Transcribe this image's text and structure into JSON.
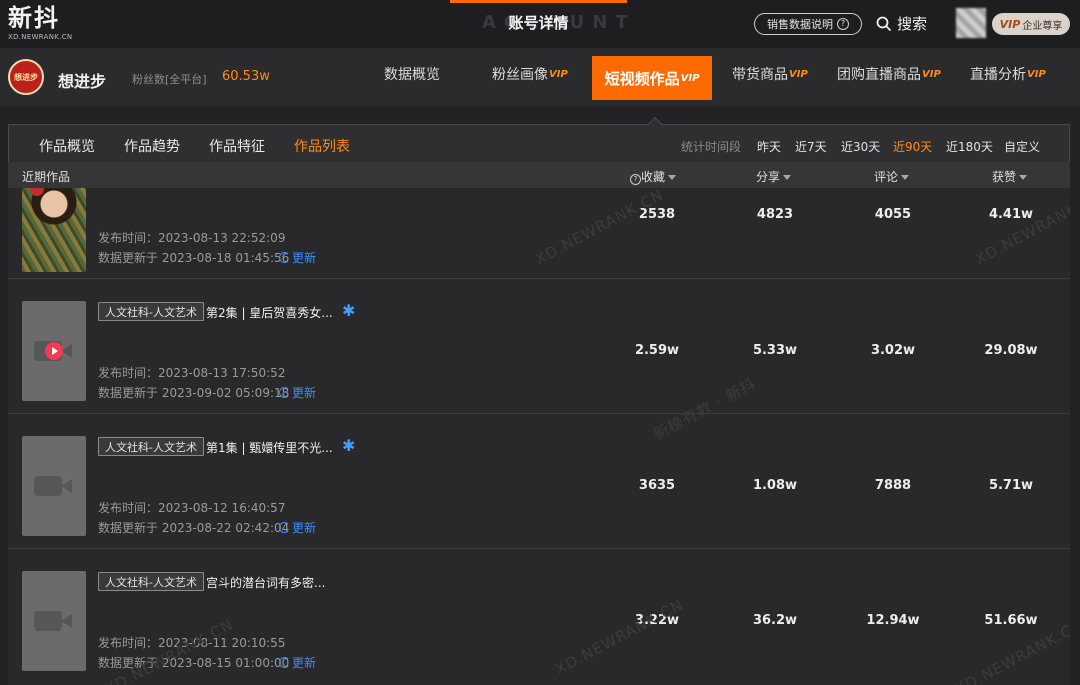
{
  "header": {
    "logo_text": "新抖",
    "logo_sub": "XD.NEWRANK.CN",
    "page_title": "账号详情",
    "page_title_ghost": "ACCOUNT",
    "sales_help": "销售数据说明",
    "search_label": "搜索",
    "vip_label": "VIP",
    "vip_text": "企业尊享"
  },
  "account": {
    "avatar_text": "想进步",
    "name": "想进步",
    "fans_label": "粉丝数[全平台]",
    "fans_value": "60.53w"
  },
  "nav_tabs": [
    {
      "label": "数据概览",
      "vip": ""
    },
    {
      "label": "粉丝画像",
      "vip": "VIP"
    },
    {
      "label": "短视频作品",
      "vip": "VIP"
    },
    {
      "label": "带货商品",
      "vip": "VIP"
    },
    {
      "label": "团购直播商品",
      "vip": "VIP"
    },
    {
      "label": "直播分析",
      "vip": "VIP"
    }
  ],
  "active_nav": "短视频作品",
  "sub_tabs": [
    "作品概览",
    "作品趋势",
    "作品特征",
    "作品列表"
  ],
  "active_sub_tab": "作品列表",
  "period": {
    "label": "统计时间段",
    "options": [
      "昨天",
      "近7天",
      "近30天",
      "近90天",
      "近180天",
      "自定义"
    ],
    "active": "近90天"
  },
  "table": {
    "section_label": "近期作品",
    "columns": [
      "收藏",
      "分享",
      "评论",
      "获赞"
    ],
    "rows": [
      {
        "category": "",
        "title": "",
        "publish_time": "发布时间：2023-08-13 22:52:09",
        "updated_time": "数据更新于 2023-08-18 01:45:56",
        "refresh_label": "更新",
        "collect": "2538",
        "share": "4823",
        "comment": "4055",
        "likes": "4.41w"
      },
      {
        "category": "人文社科-人文艺术",
        "title": "第2集 | 皇后贺喜秀女...",
        "publish_time": "发布时间：2023-08-13 17:50:52",
        "updated_time": "数据更新于 2023-09-02 05:09:18",
        "refresh_label": "更新",
        "collect": "2.59w",
        "share": "5.33w",
        "comment": "3.02w",
        "likes": "29.08w"
      },
      {
        "category": "人文社科-人文艺术",
        "title": "第1集 | 甄嬛传里不光...",
        "publish_time": "发布时间：2023-08-12 16:40:57",
        "updated_time": "数据更新于 2023-08-22 02:42:04",
        "refresh_label": "更新",
        "collect": "3635",
        "share": "1.08w",
        "comment": "7888",
        "likes": "5.71w"
      },
      {
        "category": "人文社科-人文艺术",
        "title": "宫斗的潜台词有多密...",
        "publish_time": "发布时间：2023-08-11 20:10:55",
        "updated_time": "数据更新于 2023-08-15 01:00:00",
        "refresh_label": "更新",
        "collect": "3.22w",
        "share": "36.2w",
        "comment": "12.94w",
        "likes": "51.66w"
      }
    ]
  },
  "watermarks": [
    "XD.NEWRANK.CN",
    "新榜有数 · 新抖"
  ],
  "colors": {
    "accent": "#ff6a00",
    "link": "#3f8cff",
    "bg": "#232325"
  }
}
